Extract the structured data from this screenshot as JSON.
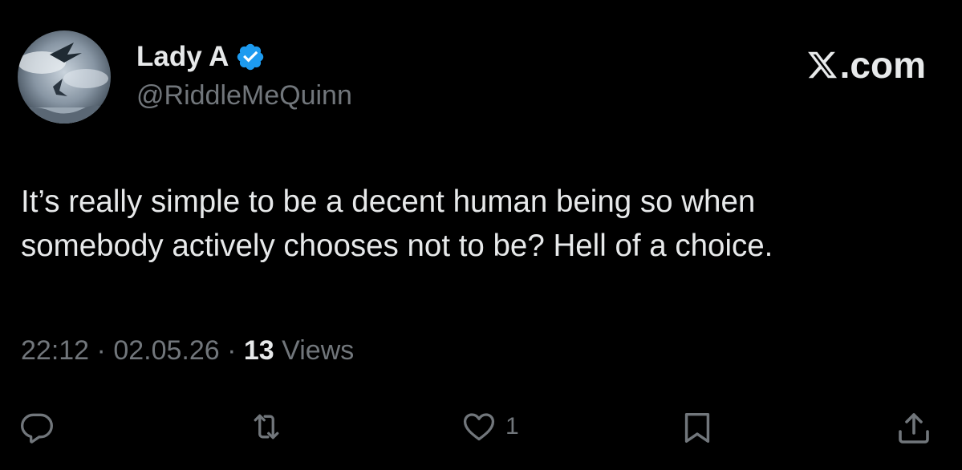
{
  "author": {
    "display_name": "Lady A",
    "handle": "@RiddleMeQuinn",
    "verified_icon": "verified-badge-icon",
    "verified_color": "#1d9bf0",
    "avatar": "avatar-image"
  },
  "brand": {
    "label": ".com",
    "icon": "x-logo-icon"
  },
  "tweet": {
    "text": "It’s really simple to be a decent human being so when\nsomebody actively chooses not to be? Hell of a choice."
  },
  "meta": {
    "time": "22:12",
    "sep1": " · ",
    "date": "02.05.26",
    "sep2": " · ",
    "views_count": "13",
    "views_label": " Views"
  },
  "actions": {
    "reply_icon": "reply-icon",
    "retweet_icon": "retweet-icon",
    "like_icon": "heart-icon",
    "like_count": "1",
    "bookmark_icon": "bookmark-icon",
    "share_icon": "share-icon"
  },
  "colors": {
    "background": "#000000",
    "primary_text": "#e7e9ea",
    "secondary_text": "#71767b"
  }
}
